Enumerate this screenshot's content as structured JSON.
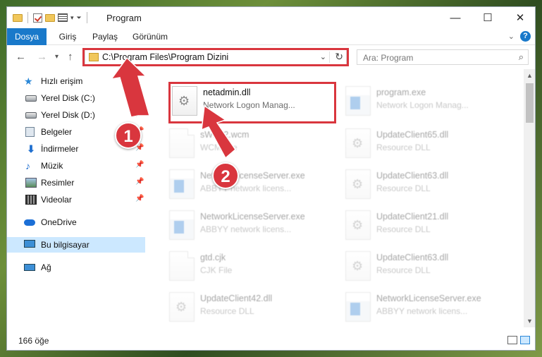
{
  "window": {
    "title": "Program"
  },
  "ribbon": {
    "tabs": [
      "Dosya",
      "Giriş",
      "Paylaş",
      "Görünüm"
    ]
  },
  "nav": {
    "address": "C:\\Program Files\\Program Dizini",
    "search_placeholder": "Ara: Program"
  },
  "sidebar": {
    "items": [
      {
        "label": "Hızlı erişim",
        "icon": "star-icon",
        "pinned": false
      },
      {
        "label": "Yerel Disk (C:)",
        "icon": "drive-icon",
        "pinned": true
      },
      {
        "label": "Yerel Disk (D:)",
        "icon": "drive-icon",
        "pinned": true
      },
      {
        "label": "Belgeler",
        "icon": "documents-icon",
        "pinned": true
      },
      {
        "label": "İndirmeler",
        "icon": "download-icon",
        "pinned": true
      },
      {
        "label": "Müzik",
        "icon": "music-icon",
        "pinned": true
      },
      {
        "label": "Resimler",
        "icon": "pictures-icon",
        "pinned": true
      },
      {
        "label": "Videolar",
        "icon": "video-icon",
        "pinned": true
      },
      {
        "label": "OneDrive",
        "icon": "cloud-icon",
        "pinned": false
      },
      {
        "label": "Bu bilgisayar",
        "icon": "computer-icon",
        "pinned": false,
        "selected": true
      },
      {
        "label": "Ağ",
        "icon": "network-icon",
        "pinned": false
      }
    ]
  },
  "files": {
    "highlighted": {
      "name": "netadmin.dll",
      "desc": "Network Logon Manag..."
    },
    "col1": [
      {
        "name": "sWP12.wcm",
        "desc": "WCM File",
        "icon": "blank-file-icon"
      },
      {
        "name": "NetworkLicenseServer.exe",
        "desc": "ABBYY network licens...",
        "icon": "exe-icon"
      },
      {
        "name": "NetworkLicenseServer.exe",
        "desc": "ABBYY network licens...",
        "icon": "exe-icon"
      },
      {
        "name": "gtd.cjk",
        "desc": "CJK File",
        "icon": "blank-file-icon"
      },
      {
        "name": "UpdateClient42.dll",
        "desc": "Resource DLL",
        "icon": "dll-icon"
      }
    ],
    "col2": [
      {
        "name": "program.exe",
        "desc": "Network Logon Manag...",
        "icon": "exe-icon"
      },
      {
        "name": "UpdateClient65.dll",
        "desc": "Resource DLL",
        "icon": "dll-icon"
      },
      {
        "name": "UpdateClient63.dll",
        "desc": "Resource DLL",
        "icon": "dll-icon"
      },
      {
        "name": "UpdateClient21.dll",
        "desc": "Resource DLL",
        "icon": "dll-icon"
      },
      {
        "name": "UpdateClient63.dll",
        "desc": "Resource DLL",
        "icon": "dll-icon"
      },
      {
        "name": "NetworkLicenseServer.exe",
        "desc": "ABBYY network licens...",
        "icon": "exe-icon"
      }
    ]
  },
  "status": {
    "count": "166 öğe"
  },
  "annotations": {
    "step1": "1",
    "step2": "2",
    "color": "#d9363e"
  }
}
